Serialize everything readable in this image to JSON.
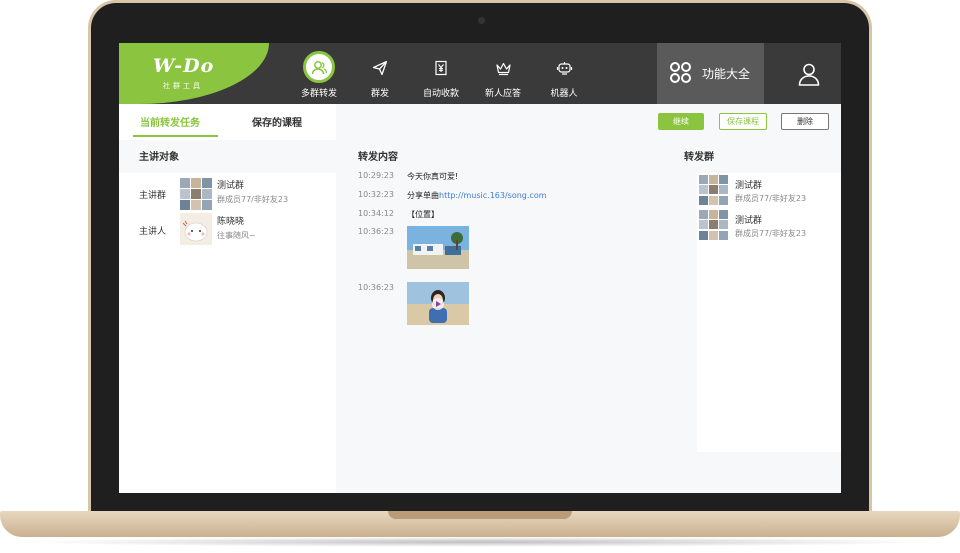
{
  "header": {
    "logo_text": "W-Do",
    "logo_sub": "社群工具",
    "nav": [
      {
        "label": "多群转发",
        "icon": "users-icon",
        "active": true
      },
      {
        "label": "群发",
        "icon": "paper-plane-icon",
        "active": false
      },
      {
        "label": "自动收款",
        "icon": "yen-receipt-icon",
        "active": false
      },
      {
        "label": "新人应答",
        "icon": "crown-icon",
        "active": false
      },
      {
        "label": "机器人",
        "icon": "robot-icon",
        "active": false
      }
    ],
    "all_functions_label": "功能大全"
  },
  "tabs": {
    "current_task": "当前转发任务",
    "saved_courses": "保存的课程"
  },
  "buttons": {
    "continue": "继续",
    "save_course": "保存课程",
    "delete": "删除"
  },
  "left": {
    "title": "主讲对象",
    "group_label": "主讲群",
    "group_name": "测试群",
    "group_sub": "群成员77/非好友23",
    "speaker_label": "主讲人",
    "speaker_name": "陈晓晓",
    "speaker_sub": "往事随风~"
  },
  "middle": {
    "title": "转发内容",
    "messages": [
      {
        "time": "10:29:23",
        "text": "今天你真可爱!"
      },
      {
        "time": "10:32:23",
        "text": "分享单曲",
        "link": "http://music.163/song.com"
      },
      {
        "time": "10:34:12",
        "text": "【位置】"
      },
      {
        "time": "10:36:23",
        "text": ""
      },
      {
        "time": "10:36:23",
        "text": ""
      }
    ]
  },
  "right": {
    "title": "转发群",
    "groups": [
      {
        "name": "测试群",
        "sub": "群成员77/非好友23"
      },
      {
        "name": "测试群",
        "sub": "群成员77/非好友23"
      }
    ]
  },
  "colors": {
    "accent": "#8bc540",
    "header_bg": "#3a3a3a",
    "link": "#3a7bd5"
  }
}
